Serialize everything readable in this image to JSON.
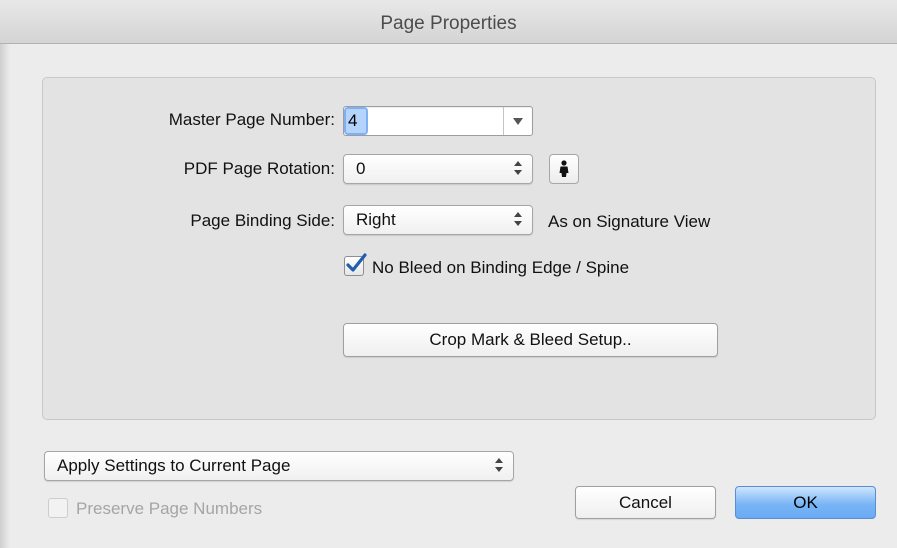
{
  "window": {
    "title": "Page Properties"
  },
  "page_settings": {
    "master_page_number": {
      "label": "Master Page Number:",
      "value": "4"
    },
    "pdf_page_rotation": {
      "label": "PDF Page Rotation:",
      "value": "0"
    },
    "page_binding_side": {
      "label": "Page Binding Side:",
      "value": "Right",
      "note": "As on Signature View"
    },
    "no_bleed_on_binding_edge": {
      "label": "No Bleed on Binding Edge / Spine",
      "checked": true
    },
    "crop_mark_button": {
      "label": "Crop Mark & Bleed Setup.."
    }
  },
  "footer": {
    "apply_scope": {
      "value": "Apply Settings to Current Page"
    },
    "preserve_page_numbers": {
      "label": "Preserve Page Numbers",
      "checked": false,
      "enabled": false
    },
    "cancel_label": "Cancel",
    "ok_label": "OK"
  },
  "icons": {
    "rotation_person": "person-icon",
    "checkmark": "checkmark-icon",
    "combo_arrow": "chevron-down-icon",
    "popup_arrows": "up-down-arrows-icon"
  },
  "colors": {
    "accent_blue": "#79b5f6",
    "selection": "#b5d4fb",
    "checkmark": "#1f5fb0"
  }
}
